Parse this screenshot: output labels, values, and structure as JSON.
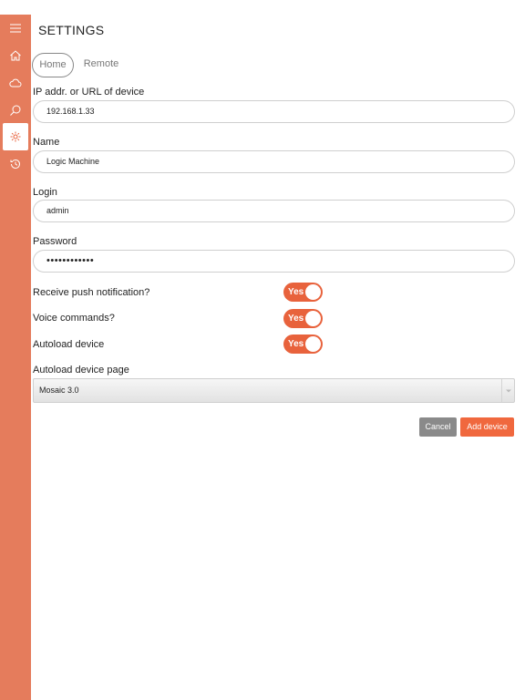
{
  "header": {
    "title": "SETTINGS"
  },
  "tabs": [
    {
      "label": "Home",
      "active": true
    },
    {
      "label": "Remote",
      "active": false
    }
  ],
  "sidebar": {
    "items": [
      {
        "icon": "menu-icon"
      },
      {
        "icon": "home-icon"
      },
      {
        "icon": "cloud-icon"
      },
      {
        "icon": "search-icon"
      },
      {
        "icon": "gear-icon",
        "active": true
      },
      {
        "icon": "history-icon"
      }
    ]
  },
  "form": {
    "ip": {
      "label": "IP addr. or URL of device",
      "value": "192.168.1.33"
    },
    "name": {
      "label": "Name",
      "value": "Logic Machine"
    },
    "login": {
      "label": "Login",
      "value": "admin"
    },
    "password": {
      "label": "Password",
      "value": "••••••••••••"
    },
    "push": {
      "label": "Receive push notification?",
      "toggle": "Yes"
    },
    "voice": {
      "label": "Voice commands?",
      "toggle": "Yes"
    },
    "autoload": {
      "label": "Autoload device",
      "toggle": "Yes"
    },
    "autoload_page": {
      "label": "Autoload device page",
      "value": "Mosaic 3.0"
    }
  },
  "buttons": {
    "cancel": "Cancel",
    "add": "Add device"
  },
  "colors": {
    "sidebar": "#e57c5c",
    "accent": "#e8623c",
    "cancel": "#8a8a8a"
  }
}
